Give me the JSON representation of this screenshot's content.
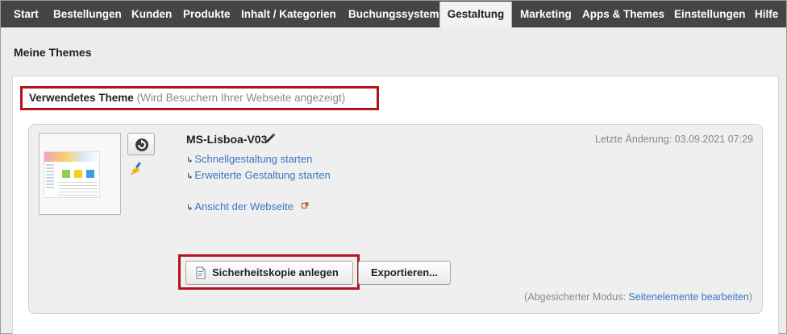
{
  "nav": {
    "tabs": [
      {
        "label": "Start",
        "active": false
      },
      {
        "label": "Bestellungen",
        "active": false
      },
      {
        "label": "Kunden",
        "active": false
      },
      {
        "label": "Produkte",
        "active": false
      },
      {
        "label": "Inhalt / Kategorien",
        "active": false
      },
      {
        "label": "Buchungssystem",
        "active": false
      },
      {
        "label": "Gestaltung",
        "active": true
      },
      {
        "label": "Marketing",
        "active": false
      },
      {
        "label": "Apps & Themes",
        "active": false
      },
      {
        "label": "Einstellungen",
        "active": false
      },
      {
        "label": "Hilfe",
        "active": false
      }
    ]
  },
  "page": {
    "title": "Meine Themes"
  },
  "section": {
    "title": "Verwendetes Theme",
    "subtitle": "(Wird Besuchern Ihrer Webseite angezeigt)"
  },
  "theme": {
    "name": "MS-Lisboa-V03",
    "last_change": "Letzte Änderung: 03.09.2021 07:29",
    "links": {
      "quick_design": "Schnellgestaltung starten",
      "advanced_design": "Erweiterte Gestaltung starten",
      "view_site": "Ansicht der Webseite"
    },
    "buttons": {
      "backup": "Sicherheitskopie anlegen",
      "export": "Exportieren..."
    },
    "safe_mode": {
      "prefix": "(Abgesicherter Modus: ",
      "link": "Seitenelemente bearbeiten",
      "suffix": ")"
    }
  },
  "icons": {
    "refresh": "refresh-icon",
    "brush": "brush-icon",
    "pencil": "pencil-icon",
    "link_arrow": "arrow-right-icon",
    "external": "external-link-icon",
    "document": "document-icon"
  },
  "colors": {
    "nav_bg": "#454545",
    "highlight": "#b5121b",
    "link": "#3a77c3"
  }
}
